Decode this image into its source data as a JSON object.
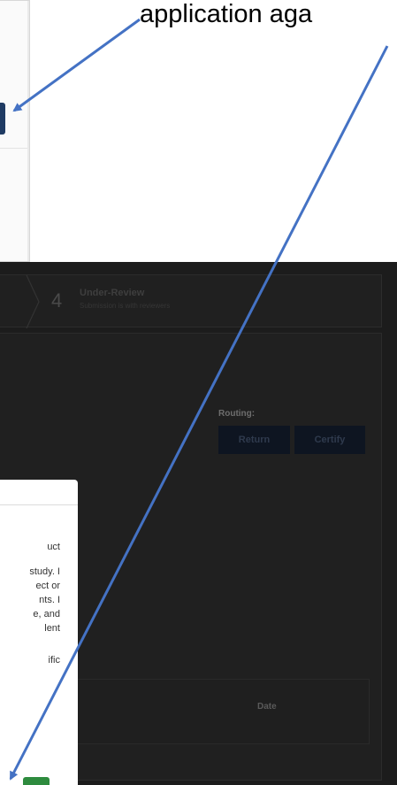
{
  "caption": {
    "text": "application aga"
  },
  "stepper": {
    "step_number": "4",
    "step_title": "Under-Review",
    "step_subtitle": "Submission is with reviewers"
  },
  "routing": {
    "label": "Routing:",
    "return_label": "Return",
    "certify_label": "Certify"
  },
  "table": {
    "date_header": "Date"
  },
  "modal": {
    "lines": [
      "uct",
      "study. I",
      "ect or",
      "nts. I",
      "e, and",
      "lent",
      "ific"
    ]
  },
  "colors": {
    "arrow": "#4472c4",
    "dark_background": "#1c1c1c",
    "button_dark": "#0e1521",
    "ok_button": "#2e8b3e"
  }
}
